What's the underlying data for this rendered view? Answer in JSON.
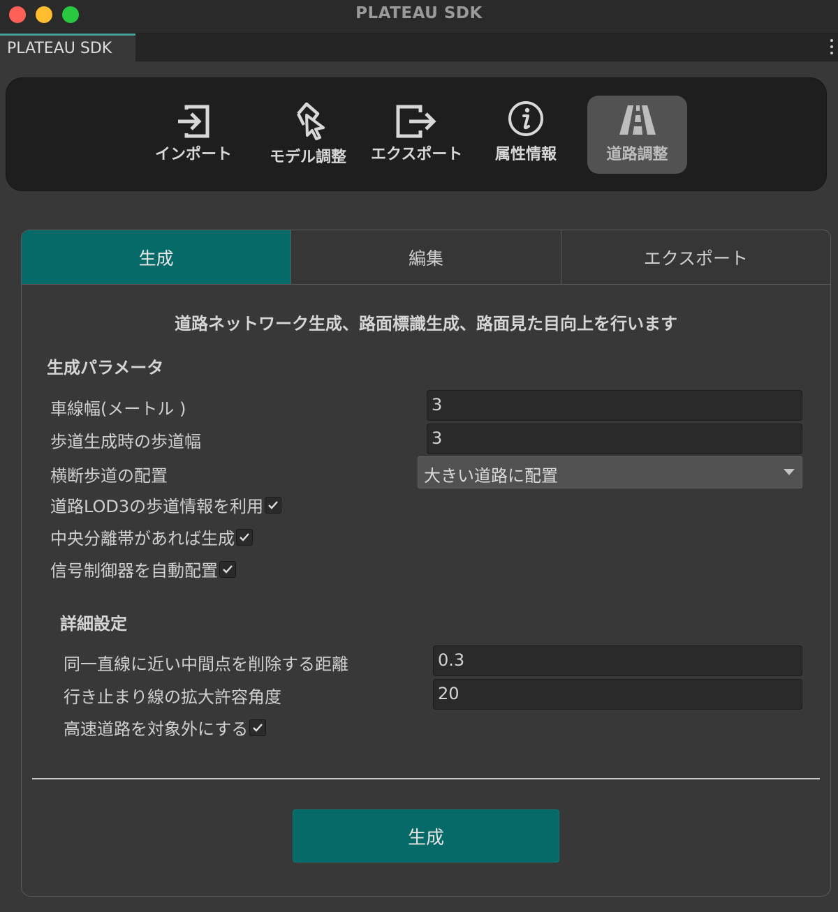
{
  "window": {
    "title": "PLATEAU SDK",
    "tab_label": "PLATEAU SDK"
  },
  "toolbar": {
    "items": [
      {
        "label": "インポート",
        "icon": "import-icon"
      },
      {
        "label": "モデル調整",
        "icon": "model-adjust-icon"
      },
      {
        "label": "エクスポート",
        "icon": "export-icon"
      },
      {
        "label": "属性情報",
        "icon": "info-icon"
      },
      {
        "label": "道路調整",
        "icon": "road-icon",
        "active": true
      }
    ]
  },
  "tabs": [
    {
      "label": "生成",
      "active": true
    },
    {
      "label": "編集"
    },
    {
      "label": "エクスポート"
    }
  ],
  "content": {
    "description": "道路ネットワーク生成、路面標識生成、路面見た目向上を行います",
    "params_title": "生成パラメータ",
    "lane_width_label": "車線幅(メートル )",
    "lane_width_value": "3",
    "sidewalk_width_label": "歩道生成時の歩道幅",
    "sidewalk_width_value": "3",
    "crosswalk_label": "横断歩道の配置",
    "crosswalk_value": "大きい道路に配置",
    "use_lod3_label": "道路LOD3の歩道情報を利用",
    "use_lod3_checked": true,
    "median_label": "中央分離帯があれば生成",
    "median_checked": true,
    "signal_label": "信号制御器を自動配置",
    "signal_checked": true,
    "detail_title": "詳細設定",
    "remove_dist_label": "同一直線に近い中間点を削除する距離",
    "remove_dist_value": "0.3",
    "dead_end_label": "行き止まり線の拡大許容角度",
    "dead_end_value": "20",
    "exclude_highway_label": "高速道路を対象外にする",
    "exclude_highway_checked": true,
    "generate_button": "生成"
  },
  "colors": {
    "accent": "#066a68",
    "background": "#383838",
    "toolbar_bg": "#1e1e1e"
  }
}
